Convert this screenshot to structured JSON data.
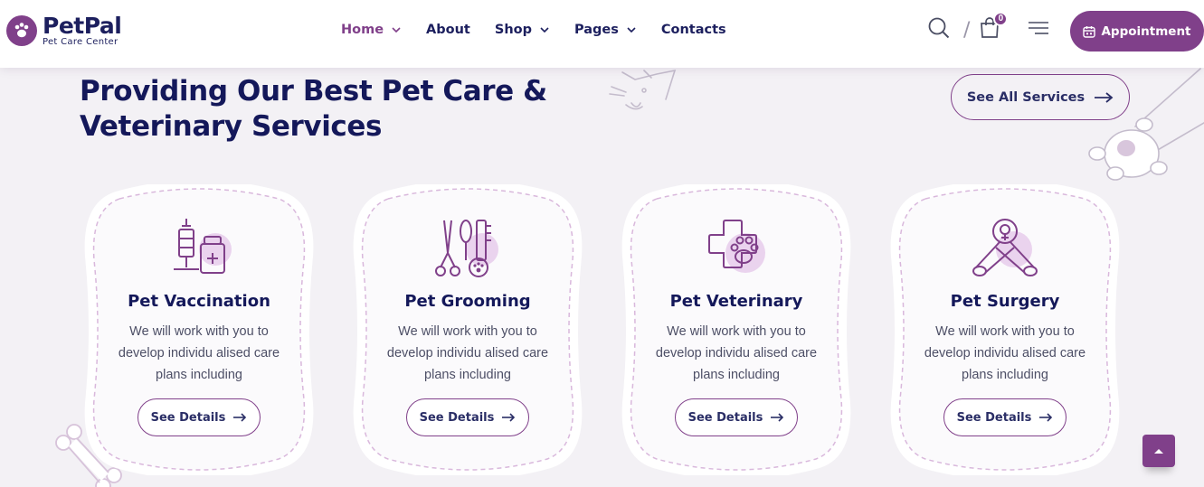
{
  "brand": {
    "name": "PetPal",
    "tagline": "Pet Care Center",
    "accent": "#80408a",
    "navy": "#14185a"
  },
  "nav": {
    "items": [
      {
        "label": "Home",
        "has_dropdown": true,
        "active": true
      },
      {
        "label": "About",
        "has_dropdown": false,
        "active": false
      },
      {
        "label": "Shop",
        "has_dropdown": true,
        "active": false
      },
      {
        "label": "Pages",
        "has_dropdown": true,
        "active": false
      },
      {
        "label": "Contacts",
        "has_dropdown": false,
        "active": false
      }
    ]
  },
  "header": {
    "cart_count": "0",
    "appointment_label": "Appointment",
    "divider": "/",
    "icons": [
      "search-icon",
      "cart-icon",
      "menu-icon",
      "calendar-icon"
    ]
  },
  "section": {
    "title": "Providing Our Best Pet Care & Veterinary Services",
    "see_all_label": "See All Services"
  },
  "services": [
    {
      "title": "Pet Vaccination",
      "description": "We will work with you to develop individu alised care plans including",
      "button": "See Details",
      "icon": "vaccine-icon"
    },
    {
      "title": "Pet Grooming",
      "description": "We will work with you to develop individu alised care plans including",
      "button": "See Details",
      "icon": "grooming-icon"
    },
    {
      "title": "Pet Veterinary",
      "description": "We will work with you to develop individu alised care plans including",
      "button": "See Details",
      "icon": "veterinary-icon"
    },
    {
      "title": "Pet Surgery",
      "description": "We will work with you to develop individu alised care plans including",
      "button": "See Details",
      "icon": "surgery-icon"
    }
  ]
}
